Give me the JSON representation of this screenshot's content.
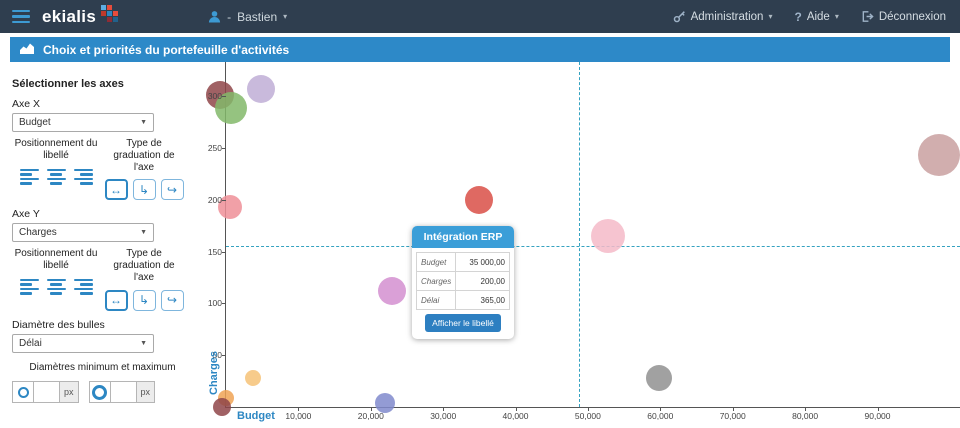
{
  "navbar": {
    "brand": "ekialis",
    "user_prefix": "-",
    "user_name": "Bastien",
    "admin_label": "Administration",
    "aide_label": "Aide",
    "logout_label": "Déconnexion"
  },
  "titlebar": {
    "title": "Choix et priorités du portefeuille d'activités"
  },
  "icons": {
    "caret_down": "▾",
    "select_caret": "▼",
    "axis_straight": "↔",
    "axis_wrap": "↳",
    "axis_curve": "↪",
    "help": "?"
  },
  "sidebar": {
    "section_title": "Sélectionner les axes",
    "axe_x_label": "Axe X",
    "axe_x_value": "Budget",
    "axe_y_label": "Axe Y",
    "axe_y_value": "Charges",
    "pos_label": "Positionnement du libellé",
    "grad_label": "Type de graduation de l'axe",
    "bubble_label": "Diamètre des bulles",
    "bubble_value": "Délai",
    "diam_label": "Diamètres minimum et maximum",
    "px_label": "px"
  },
  "tooltip": {
    "title": "Intégration ERP",
    "rows": [
      {
        "label": "Budget",
        "value": "35 000,00"
      },
      {
        "label": "Charges",
        "value": "200,00"
      },
      {
        "label": "Délai",
        "value": "365,00"
      }
    ],
    "button_label": "Afficher le libellé"
  },
  "chart_data": {
    "type": "scatter",
    "title": "Choix et priorités du portefeuille d'activités",
    "xlabel": "Budget",
    "ylabel": "Charges",
    "xlim": [
      0,
      101400
    ],
    "ylim": [
      0,
      333
    ],
    "grid": false,
    "x_ticks": [
      {
        "v": 10000,
        "label": "10,000"
      },
      {
        "v": 20000,
        "label": "20,000"
      },
      {
        "v": 30000,
        "label": "30,000"
      },
      {
        "v": 40000,
        "label": "40,000"
      },
      {
        "v": 50000,
        "label": "50,000"
      },
      {
        "v": 60000,
        "label": "60,000"
      },
      {
        "v": 70000,
        "label": "70,000"
      },
      {
        "v": 80000,
        "label": "80,000"
      },
      {
        "v": 90000,
        "label": "90,000"
      }
    ],
    "y_ticks": [
      {
        "v": 50,
        "label": "50"
      },
      {
        "v": 100,
        "label": "100"
      },
      {
        "v": 150,
        "label": "150"
      },
      {
        "v": 200,
        "label": "200"
      },
      {
        "v": 250,
        "label": "250"
      },
      {
        "v": 300,
        "label": "300"
      }
    ],
    "crosshair": {
      "x": 48700,
      "y": 155,
      "color": "#35a2c0"
    },
    "points": [
      {
        "name": "bubble",
        "x": -800,
        "y": 301,
        "r": 14,
        "color": "#8f4549"
      },
      {
        "name": "bubble",
        "x": 700,
        "y": 289,
        "r": 16,
        "color": "#83b96a"
      },
      {
        "name": "bubble",
        "x": 4800,
        "y": 307,
        "r": 14,
        "color": "#bfaed6"
      },
      {
        "name": "bubble",
        "x": 500,
        "y": 193,
        "r": 12,
        "color": "#ee8f98"
      },
      {
        "name": "Intégration ERP",
        "x": 35000,
        "y": 200,
        "r": 14,
        "color": "#d94f46"
      },
      {
        "name": "bubble",
        "x": 52800,
        "y": 165,
        "r": 17,
        "color": "#f4bac8"
      },
      {
        "name": "bubble",
        "x": 98500,
        "y": 243,
        "r": 21,
        "color": "#c9a0a0"
      },
      {
        "name": "bubble",
        "x": 22900,
        "y": 112,
        "r": 14,
        "color": "#d48fd0"
      },
      {
        "name": "bubble",
        "x": 59800,
        "y": 28,
        "r": 13,
        "color": "#909090"
      },
      {
        "name": "bubble",
        "x": 3700,
        "y": 28,
        "r": 8,
        "color": "#f6c277"
      },
      {
        "name": "bubble",
        "x": 22000,
        "y": 4,
        "r": 10,
        "color": "#8089cc"
      },
      {
        "name": "bubble",
        "x": 0,
        "y": 9,
        "r": 8,
        "color": "#f0a355"
      },
      {
        "name": "bubble",
        "x": -500,
        "y": 0,
        "r": 9,
        "color": "#8f4549"
      }
    ]
  }
}
